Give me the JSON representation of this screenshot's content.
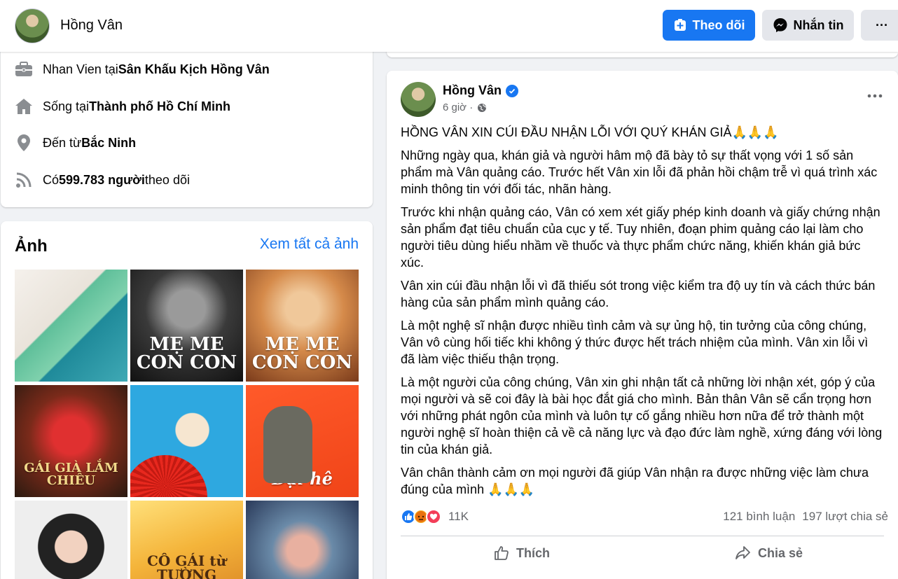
{
  "header": {
    "name": "Hồng Vân",
    "follow_label": "Theo dõi",
    "message_label": "Nhắn tin",
    "more_label": "···"
  },
  "intro": {
    "work": {
      "prefix": "Nhan Vien tại ",
      "bold": "Sân Khấu Kịch Hồng Vân"
    },
    "lives": {
      "prefix": "Sống tại ",
      "bold": "Thành phố Hồ Chí Minh"
    },
    "from": {
      "prefix": "Đến từ ",
      "bold": "Bắc Ninh"
    },
    "followers": {
      "prefix": "Có ",
      "bold": "599.783 người",
      "suffix": " theo dõi"
    }
  },
  "photos": {
    "title": "Ảnh",
    "see_all": "Xem tất cả ảnh",
    "captions": [
      "",
      "MẸ ME CON CON",
      "MẸ ME CON CON",
      "GÁI GIÀ LẮM CHIÊU",
      "",
      "Đại hê",
      "",
      "CÔ GÁI từ TƯỜNG",
      ""
    ]
  },
  "post": {
    "author": "Hồng Vân",
    "time": "6 giờ ·",
    "more_label": "•••",
    "paragraphs": [
      "HỒNG VÂN XIN CÚI ĐẦU NHẬN LỖI VỚI QUÝ KHÁN GIẢ🙏🙏🙏",
      "Những ngày qua, khán giả và người hâm mộ đã bày tỏ sự thất vọng với 1 số sản phẩm mà Vân quảng cáo. Trước hết Vân xin lỗi đã phản hồi chậm trễ vì quá trình xác minh thông tin với đối tác, nhãn hàng.",
      "Trước khi nhận quảng cáo, Vân có xem xét giấy phép kinh doanh và giấy chứng nhận sản phẩm đạt tiêu chuẩn của cục y tế. Tuy nhiên, đoạn phim quảng cáo lại làm cho người tiêu dùng hiểu nhầm về thuốc và thực phẩm chức năng, khiến khán giả bức xúc.",
      "Vân xin cúi đầu nhận lỗi vì đã thiếu sót trong việc kiểm tra độ uy tín và cách thức bán hàng của sản phẩm mình quảng cáo.",
      "Là một nghệ sĩ nhận được nhiều tình cảm và sự ủng hộ, tin tưởng của công chúng, Vân vô cùng hối tiếc khi không ý thức được hết trách nhiệm của mình. Vân xin lỗi vì đã làm việc thiếu thận trọng.",
      " Là một người của công chúng, Vân xin ghi nhận tất cả những lời nhận xét, góp ý của mọi người và sẽ coi đây là bài học đắt giá cho mình. Bản thân Vân sẽ cẩn trọng hơn với những phát ngôn của mình và luôn tự cố gắng nhiều hơn nữa để trở thành một người nghệ sĩ hoàn thiện cả về cả năng lực và đạo đức làm nghề, xứng đáng với lòng tin của khán giả.",
      "Vân chân thành cảm ơn mọi người đã giúp Vân nhận ra được những việc làm chưa đúng của mình 🙏🙏🙏"
    ],
    "reaction_count": "11K",
    "comments": "121 bình luận",
    "shares": "197 lượt chia sẻ",
    "like_label": "Thích",
    "share_label": "Chia sẻ"
  },
  "colors": {
    "accent": "#1877f2",
    "background": "#f0f2f5",
    "secondary_text": "#65676b"
  }
}
